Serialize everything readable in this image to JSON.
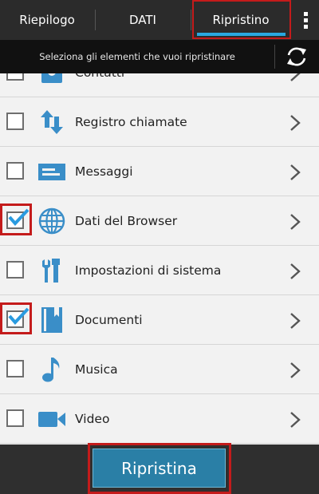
{
  "tabs": [
    {
      "label": "Riepilogo",
      "active": false
    },
    {
      "label": "DATI",
      "active": false
    },
    {
      "label": "Ripristino",
      "active": true
    }
  ],
  "subheader": {
    "text": "Seleziona gli elementi che vuoi ripristinare",
    "refresh_icon": "refresh-icon"
  },
  "items": [
    {
      "label": "Contatti",
      "checked": false,
      "icon": "contacts-icon"
    },
    {
      "label": "Registro chiamate",
      "checked": false,
      "icon": "call-log-icon"
    },
    {
      "label": "Messaggi",
      "checked": false,
      "icon": "message-icon"
    },
    {
      "label": "Dati del Browser",
      "checked": true,
      "icon": "globe-icon"
    },
    {
      "label": "Impostazioni di sistema",
      "checked": false,
      "icon": "tools-icon"
    },
    {
      "label": "Documenti",
      "checked": true,
      "icon": "document-icon"
    },
    {
      "label": "Musica",
      "checked": false,
      "icon": "music-note-icon"
    },
    {
      "label": "Video",
      "checked": false,
      "icon": "video-camera-icon"
    }
  ],
  "restore_button": {
    "label": "Ripristina"
  },
  "colors": {
    "accent": "#29a8e0",
    "icon": "#3a8ec8",
    "highlight": "#c41b1b",
    "button": "#2a7fa6"
  }
}
